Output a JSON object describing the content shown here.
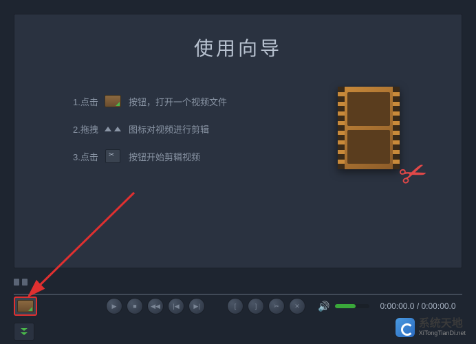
{
  "wizard": {
    "title": "使用向导",
    "steps": [
      {
        "prefix": "1.点击",
        "suffix": "按钮，打开一个视频文件",
        "icon": "folder"
      },
      {
        "prefix": "2.拖拽",
        "suffix": "图标对视频进行剪辑",
        "icon": "arrows"
      },
      {
        "prefix": "3.点击",
        "suffix": "按钮开始剪辑视频",
        "icon": "cut"
      }
    ]
  },
  "playback": {
    "time_current": "0:00:00.0",
    "time_total": "0:00:00.0",
    "volume_percent": 60
  },
  "watermark": {
    "name_cn": "系统天地",
    "name_en": "XiTongTianDi.net"
  }
}
